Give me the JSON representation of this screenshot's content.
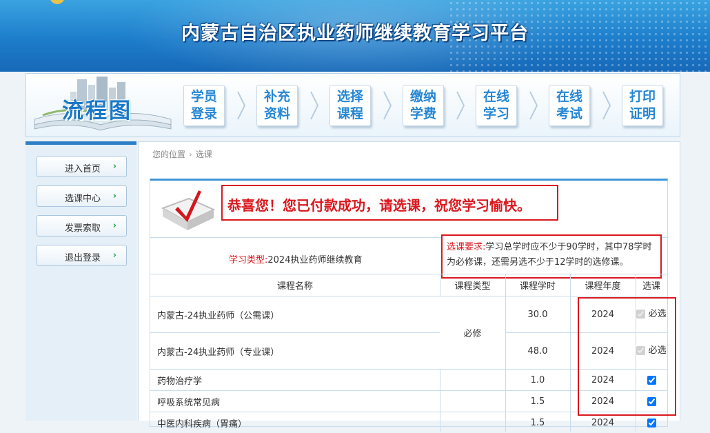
{
  "site": {
    "title": "内蒙古自治区执业药师继续教育学习平台"
  },
  "flow": {
    "title": "流程图",
    "steps": [
      {
        "line1": "学员",
        "line2": "登录"
      },
      {
        "line1": "补充",
        "line2": "资料"
      },
      {
        "line1": "选择",
        "line2": "课程"
      },
      {
        "line1": "缴纳",
        "line2": "学费"
      },
      {
        "line1": "在线",
        "line2": "学习"
      },
      {
        "line1": "在线",
        "line2": "考试"
      },
      {
        "line1": "打印",
        "line2": "证明"
      }
    ]
  },
  "sidebar": {
    "items": [
      {
        "label": "进入首页"
      },
      {
        "label": "选课中心"
      },
      {
        "label": "发票索取"
      },
      {
        "label": "退出登录"
      }
    ],
    "arrow": "›"
  },
  "breadcrumb": {
    "label": "您的位置",
    "separator": "›",
    "current": "选课"
  },
  "notice": {
    "congrats": "恭喜您！您已付款成功，请选课，祝您学习愉快。"
  },
  "study": {
    "type_label": "学习类型:",
    "type_value": "2024执业药师继续教育"
  },
  "requirement": {
    "label": "选课要求:",
    "text": "学习总学时应不少于90学时，其中78学时为必修课，还需另选不少于12学时的选修课。"
  },
  "table": {
    "headers": [
      "课程名称",
      "课程类型",
      "课程学时",
      "课程年度",
      "选课"
    ],
    "required_type": "必修",
    "required_mark": "必选",
    "rows": [
      {
        "name": "内蒙古-24执业药师（公需课）",
        "hours": "30.0",
        "year": "2024",
        "mode": "required"
      },
      {
        "name": "内蒙古-24执业药师（专业课）",
        "hours": "48.0",
        "year": "2024",
        "mode": "required"
      },
      {
        "name": "药物治疗学",
        "hours": "1.0",
        "year": "2024",
        "mode": "checked"
      },
      {
        "name": "呼吸系统常见病",
        "hours": "1.5",
        "year": "2024",
        "mode": "checked"
      },
      {
        "name": "中医内科疾病（胃痛）",
        "hours": "1.5",
        "year": "2024",
        "mode": "checked"
      }
    ]
  },
  "colors": {
    "accent_blue": "#2c7fc6",
    "alert_red": "#d9181f",
    "step_text": "#2586d3"
  }
}
